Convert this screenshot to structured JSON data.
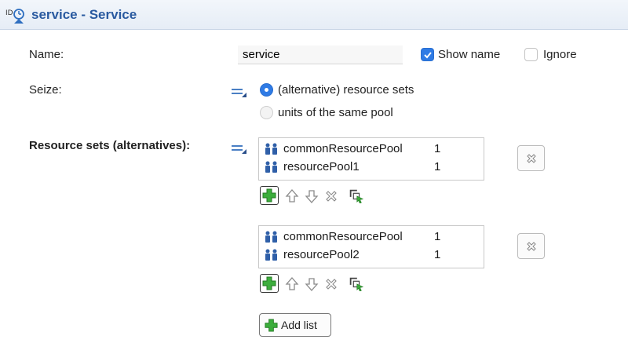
{
  "header": {
    "title": "service - Service",
    "icon": "service-block-icon"
  },
  "name_row": {
    "label": "Name:",
    "value": "service",
    "show_name": {
      "label": "Show name",
      "checked": true
    },
    "ignore": {
      "label": "Ignore",
      "checked": false
    }
  },
  "seize": {
    "label": "Seize:",
    "options": [
      {
        "label": "(alternative) resource sets",
        "selected": true
      },
      {
        "label": "units of the same pool",
        "selected": false
      }
    ]
  },
  "resource_sets": {
    "label": "Resource sets (alternatives):",
    "lists": [
      {
        "rows": [
          {
            "name": "commonResourcePool",
            "count": "1"
          },
          {
            "name": "resourcePool1",
            "count": "1"
          }
        ]
      },
      {
        "rows": [
          {
            "name": "commonResourcePool",
            "count": "1"
          },
          {
            "name": "resourcePool2",
            "count": "1"
          }
        ]
      }
    ],
    "add_list_label": "Add list"
  },
  "colors": {
    "accent": "#2f7be5",
    "title": "#2a5aa0",
    "add_green": "#3cae3c"
  }
}
